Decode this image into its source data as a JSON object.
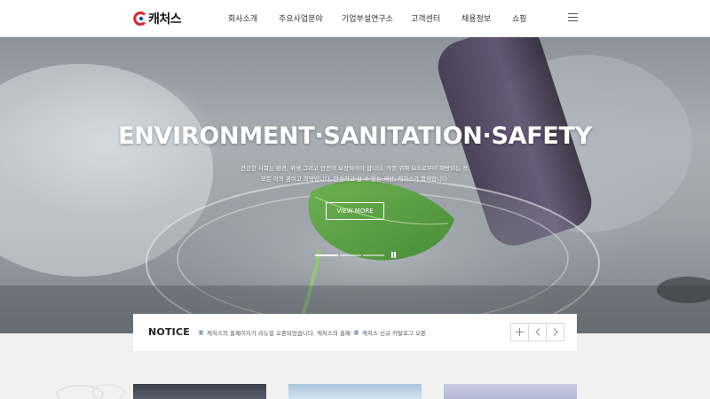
{
  "header": {
    "brand_name": "캐처스",
    "nav": [
      "회사소개",
      "주요사업분야",
      "기업부설연구소",
      "고객센터",
      "채용정보",
      "쇼핑"
    ]
  },
  "hero": {
    "title": "ENVIRONMENT·SANITATION·SAFETY",
    "desc_line1": "건강한 사회는 환경, 위생 그리고 안전이 보장되어야 합니다. 각종 위해 요소로부터 해방되는 것,",
    "desc_line2": "모든 이의 꿈이고 희망입니다. 안심하고 살 수 있는 세상, 캐처스가 함께합니다.",
    "view_more_label": "VIEW MORE",
    "slides_total": 3,
    "slide_active": 1
  },
  "notice": {
    "title": "NOTICE",
    "items": [
      "캐처스의 홈페이지가 리뉴얼 오픈되었습니다. 캐처스의 홈페···",
      "캐처스 신규 카탈로그 오픈"
    ]
  },
  "colors": {
    "brand_red": "#d7282f",
    "header_bg": "#ffffff",
    "notice_bg": "#ffffff",
    "page_bg": "#f1f1f1"
  },
  "icons": [
    "logo-mark",
    "menu-icon",
    "pause-icon",
    "doc-icon",
    "plus-icon",
    "chevron-left-icon",
    "chevron-right-icon"
  ]
}
